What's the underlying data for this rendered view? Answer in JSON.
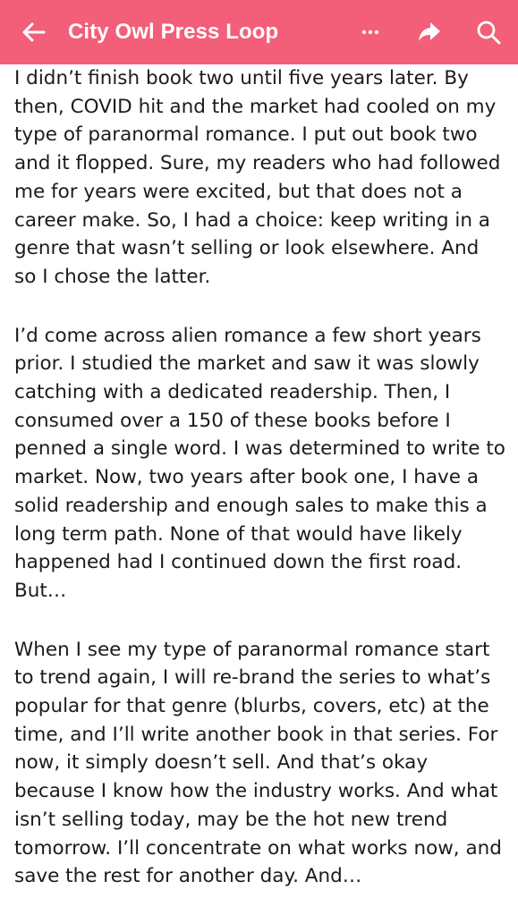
{
  "header": {
    "title": "City Owl Press Loop",
    "back_icon": "arrow-left-icon",
    "more_icon": "more-horizontal-icon",
    "share_icon": "share-icon",
    "search_icon": "search-icon",
    "background_color": "#f35e79",
    "text_color": "#ffffff"
  },
  "post": {
    "paragraphs": [
      "I didn’t finish book two until five years later. By\nthen, COVID hit and the market had cooled on my\ntype of paranormal romance. I put out book two\nand it flopped. Sure, my readers who had followed\nme for years were excited, but that does not a\ncareer make. So, I had a choice: keep writing in a\ngenre that wasn’t selling or look elsewhere. And\nso I chose the latter.",
      "I’d come across alien romance a few short years\nprior. I studied the market and saw it was slowly\ncatching with a dedicated readership. Then, I\nconsumed over a 150 of these books before I\npenned a single word. I was determined to write to\nmarket. Now, two years after book one, I have a\nsolid readership and enough sales to make this a\nlong term path. None of that would have likely\nhappened had I continued down the first road.\nBut…",
      "When I see my type of paranormal romance start\nto trend again, I will re-brand the series to what’s\npopular for that genre (blurbs, covers, etc) at the\ntime, and I’ll write another book in that series. For\nnow, it simply doesn’t sell. And that’s okay\nbecause I know how the industry works. And what\nisn’t selling today, may be the hot new trend\ntomorrow. I’ll concentrate on what works now, and\nsave the rest for another day. And…"
    ]
  }
}
